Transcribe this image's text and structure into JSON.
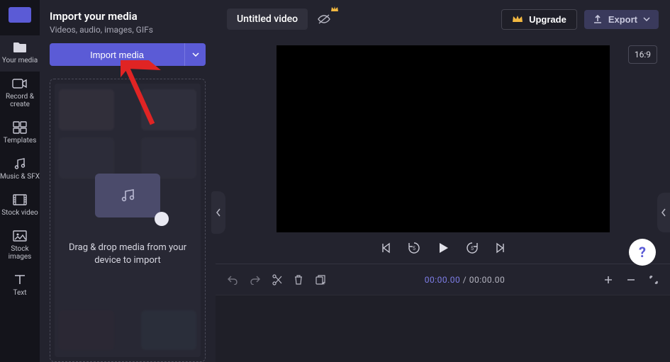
{
  "rail": {
    "items": [
      {
        "label": "Your media"
      },
      {
        "label": "Record &\ncreate"
      },
      {
        "label": "Templates"
      },
      {
        "label": "Music & SFX"
      },
      {
        "label": "Stock video"
      },
      {
        "label": "Stock\nimages"
      },
      {
        "label": "Text"
      }
    ]
  },
  "panel": {
    "title": "Import your media",
    "subtitle": "Videos, audio, images, GIFs",
    "import_label": "Import media",
    "drop_hint": "Drag & drop media from your device to import"
  },
  "topbar": {
    "title": "Untitled video",
    "upgrade": "Upgrade",
    "export": "Export"
  },
  "preview": {
    "aspect": "16:9"
  },
  "timeline": {
    "current": "00:00.00",
    "total": "00:00.00",
    "separator": " / "
  },
  "help": {
    "label": "?"
  }
}
